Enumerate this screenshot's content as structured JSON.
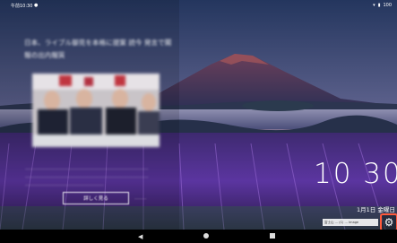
{
  "status_bar": {
    "time": "午前10:30",
    "battery": "100"
  },
  "news": {
    "headline": "日本、ライブル御見を本格に提案 読今 発言で閣報の出内報質",
    "body": "………………………………………………………………… ………………………………………………………………… …………………………………………",
    "read_more_label": "詳しく見る",
    "read_more_aside": "………"
  },
  "clock": {
    "time": "10 30",
    "date": "1月1日 金曜日"
  },
  "credit": "富士山 … (C) … Image",
  "icons": {
    "settings": "gear-icon",
    "arrow": "arrow-icon",
    "back": "back-icon",
    "home": "home-icon",
    "recents": "recents-icon",
    "wifi": "wifi-icon",
    "battery": "battery-icon"
  },
  "colors": {
    "accent_highlight": "#ff5a3c",
    "lavender": "#6b3fb0",
    "sky_top": "#2a3e6b",
    "sky_horizon": "#c98a8a"
  }
}
